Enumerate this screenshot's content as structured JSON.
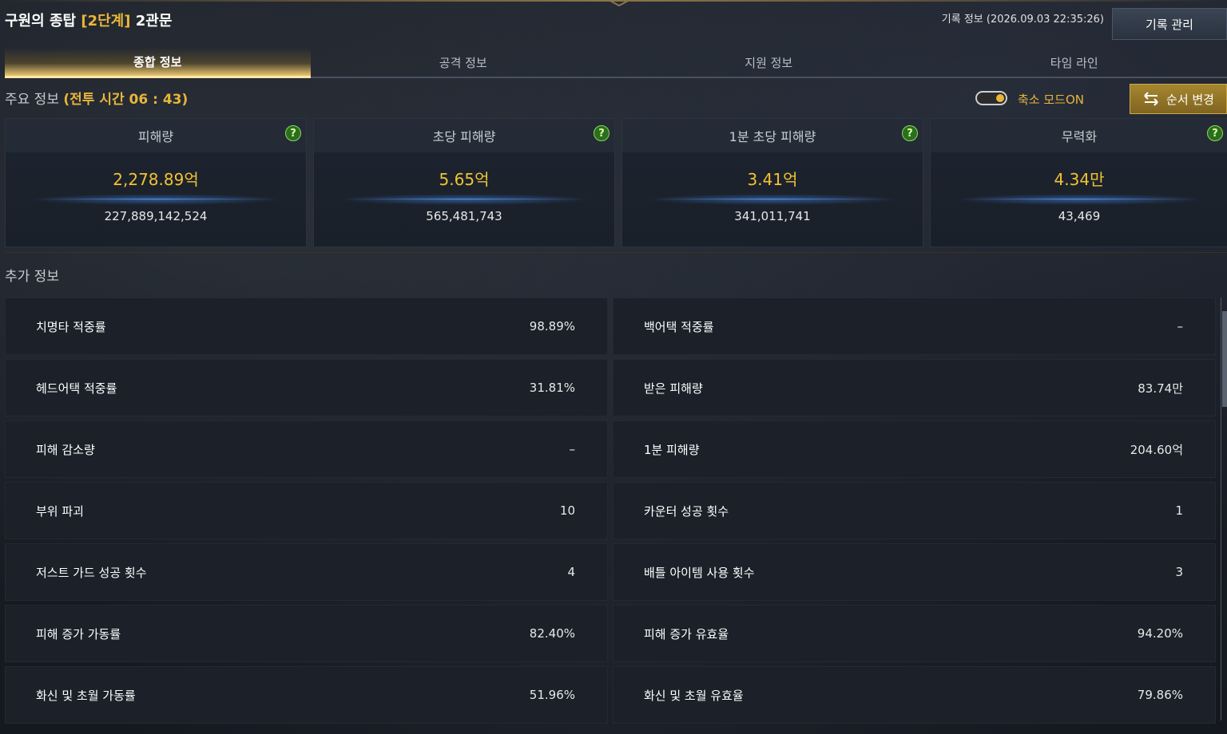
{
  "header": {
    "title_prefix": "구원의 종탑",
    "title_stage": "[2단계]",
    "title_suffix": "2관문",
    "record_info": "기록 정보 (2026.09.03 22:35:26)",
    "record_manage_label": "기록 관리"
  },
  "tabs": [
    {
      "label": "종합 정보",
      "active": true
    },
    {
      "label": "공격 정보",
      "active": false
    },
    {
      "label": "지원 정보",
      "active": false
    },
    {
      "label": "타임 라인",
      "active": false
    }
  ],
  "main_info": {
    "label": "주요 정보",
    "battle_time": "(전투 시간 06 : 43)",
    "shrink_mode_label": "축소 모드ON",
    "shrink_mode_on": true,
    "order_change_label": "순서 변경"
  },
  "cards": [
    {
      "label": "피해량",
      "value": "2,278.89억",
      "exact": "227,889,142,524"
    },
    {
      "label": "초당 피해량",
      "value": "5.65억",
      "exact": "565,481,743"
    },
    {
      "label": "1분 초당 피해량",
      "value": "3.41억",
      "exact": "341,011,741"
    },
    {
      "label": "무력화",
      "value": "4.34만",
      "exact": "43,469"
    }
  ],
  "help_glyph": "?",
  "extra_info": {
    "label": "추가 정보",
    "rows": [
      [
        {
          "label": "치명타 적중률",
          "value": "98.89%"
        },
        {
          "label": "백어택 적중률",
          "value": "–"
        }
      ],
      [
        {
          "label": "헤드어택 적중률",
          "value": "31.81%"
        },
        {
          "label": "받은 피해량",
          "value": "83.74만"
        }
      ],
      [
        {
          "label": "피해 감소량",
          "value": "–"
        },
        {
          "label": "1분 피해량",
          "value": "204.60억"
        }
      ],
      [
        {
          "label": "부위 파괴",
          "value": "10"
        },
        {
          "label": "카운터 성공 횟수",
          "value": "1"
        }
      ],
      [
        {
          "label": "저스트 가드 성공 횟수",
          "value": "4"
        },
        {
          "label": "배틀 아이템 사용 횟수",
          "value": "3"
        }
      ],
      [
        {
          "label": "피해 증가 가동률",
          "value": "82.40%"
        },
        {
          "label": "피해 증가 유효율",
          "value": "94.20%"
        }
      ],
      [
        {
          "label": "화신 및 초월 가동률",
          "value": "51.96%"
        },
        {
          "label": "화신 및 초월 유효율",
          "value": "79.86%"
        }
      ]
    ]
  },
  "colors": {
    "accent_gold": "#e8b63a",
    "value_gold": "#f1c232",
    "help_green": "#2a6e1e"
  }
}
